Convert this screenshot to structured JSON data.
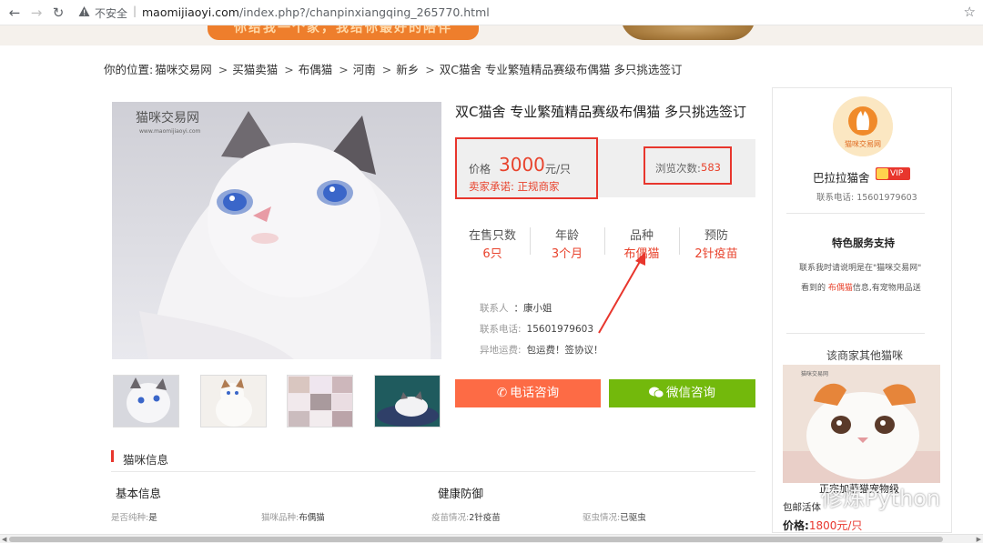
{
  "browser": {
    "insecure_label": "不安全",
    "url_host": "maomijiaoyi.com",
    "url_path": "/index.php?/chanpinxiangqing_265770.html"
  },
  "banner": {
    "slogan": "你给我一个家，我给你最好的陪伴"
  },
  "breadcrumb": {
    "prefix": "你的位置:",
    "items": [
      "猫咪交易网",
      "买猫卖猫",
      "布偶猫",
      "河南",
      "新乡",
      "双C猫舍 专业繁殖精品赛级布偶猫 多只挑选签订"
    ]
  },
  "product": {
    "photo_watermark": "猫咪交易网",
    "photo_watermark_url": "www.maomijiaoyi.com",
    "title": "双C猫舍 专业繁殖精品赛级布偶猫 多只挑选签订",
    "price_label": "价格",
    "price": "3000",
    "price_unit": "元/只",
    "promise": "卖家承诺: 正规商家",
    "views_label": "浏览次数:",
    "views": "583",
    "stats": [
      {
        "label": "在售只数",
        "value": "6只"
      },
      {
        "label": "年龄",
        "value": "3个月"
      },
      {
        "label": "品种",
        "value": "布偶猫"
      },
      {
        "label": "预防",
        "value": "2针疫苗"
      }
    ],
    "contact_label": "联系人",
    "contact": "：康小姐",
    "phone_label": "联系电话:",
    "phone": "15601979603",
    "shipping_label": "异地运费:",
    "shipping": "包运费！签协议！",
    "btn_phone": "电话咨询",
    "btn_wechat": "微信咨询"
  },
  "info": {
    "section_title": "猫咪信息",
    "basic_title": "基本信息",
    "health_title": "健康防御",
    "details": [
      {
        "label": "是否纯种:",
        "value": "是"
      },
      {
        "label": "猫咪品种:",
        "value": "布偶猫"
      },
      {
        "label": "疫苗情况:",
        "value": "2针疫苗"
      },
      {
        "label": "驱虫情况:",
        "value": "已驱虫"
      }
    ]
  },
  "shop": {
    "logo_text": "猫咪交易网",
    "name": "巴拉拉猫舍",
    "vip": "VIP",
    "phone": "联系电话: 15601979603",
    "feature_title": "特色服务支持",
    "note1": "联系我时请说明是在\"猫咪交易网\"",
    "note2_pre": "看到的",
    "note2_hl": "布偶猫",
    "note2_post": "信息,有宠物用品送",
    "other_title": "该商家其他猫咪",
    "other_caption": "包邮活体",
    "other_price_label": "价格:",
    "other_price": "1800元/只"
  },
  "watermark": {
    "text": "修炼Python",
    "overlay": "正宗加菲猫宠物级"
  },
  "colors": {
    "accent_red": "#e8362d",
    "phone_btn": "#fd6b45",
    "wechat_btn": "#73b90c"
  }
}
